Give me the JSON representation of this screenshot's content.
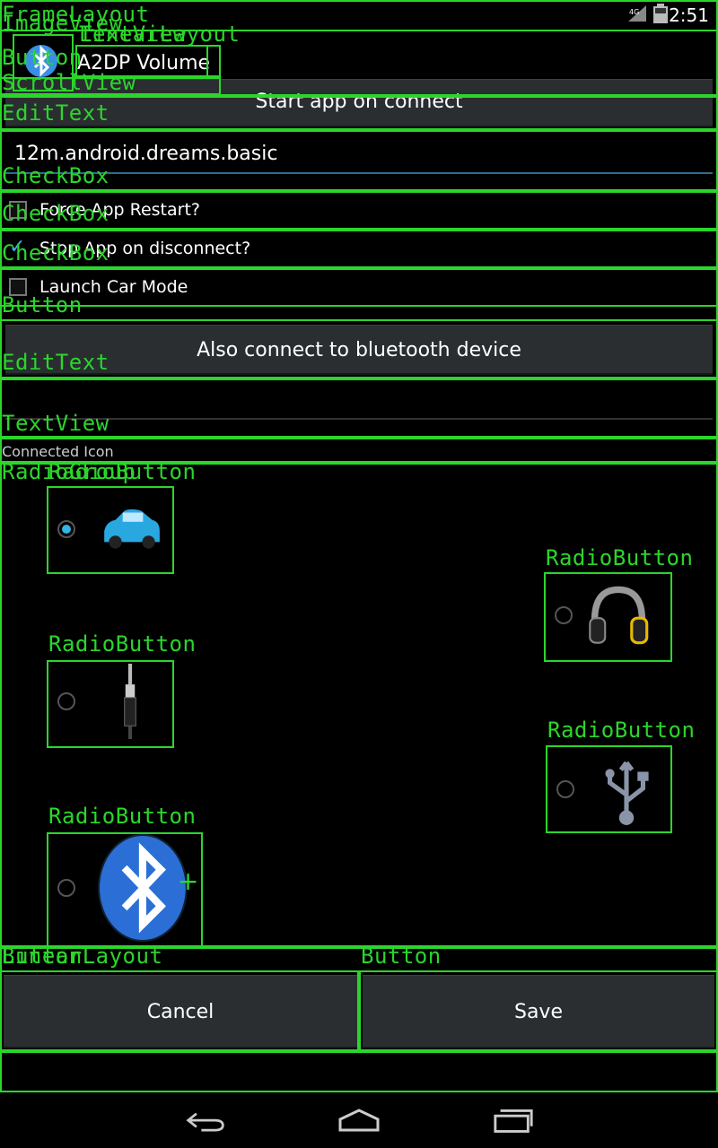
{
  "status": {
    "time": "2:51",
    "network": "4G"
  },
  "header": {
    "title": "A2DP Volume"
  },
  "actions": {
    "start_app_label": "Start app on connect"
  },
  "app_field": {
    "value": "12m.android.dreams.basic"
  },
  "checkboxes": [
    {
      "label": "Force App Restart?",
      "checked": false
    },
    {
      "label": "Stop App on disconnect?",
      "checked": true
    },
    {
      "label": "Launch Car Mode",
      "checked": false
    }
  ],
  "bluetooth": {
    "also_connect_label": "Also connect to bluetooth device",
    "field_value": ""
  },
  "icon_section": {
    "title": "Connected Icon"
  },
  "icons": [
    {
      "name": "car-icon",
      "selected": true
    },
    {
      "name": "headphones-icon",
      "selected": false
    },
    {
      "name": "audio-jack-icon",
      "selected": false
    },
    {
      "name": "usb-icon",
      "selected": false
    },
    {
      "name": "bluetooth-icon",
      "selected": false
    }
  ],
  "footer": {
    "cancel_label": "Cancel",
    "save_label": "Save"
  },
  "wireframe_labels": {
    "framelayout": "FrameLayout",
    "imageview": "ImageView",
    "linearlayout": "LinearLayout",
    "textview": "TextView",
    "button": "Button",
    "scrollview": "ScrollView",
    "edittext": "EditText",
    "checkbox": "CheckBox",
    "radiogroup": "RadioGroup",
    "radiobutton": "RadioButton"
  },
  "colors": {
    "accent": "#33b5e5",
    "wireframe": "#2bd62b",
    "button_bg": "#2a2e31"
  }
}
